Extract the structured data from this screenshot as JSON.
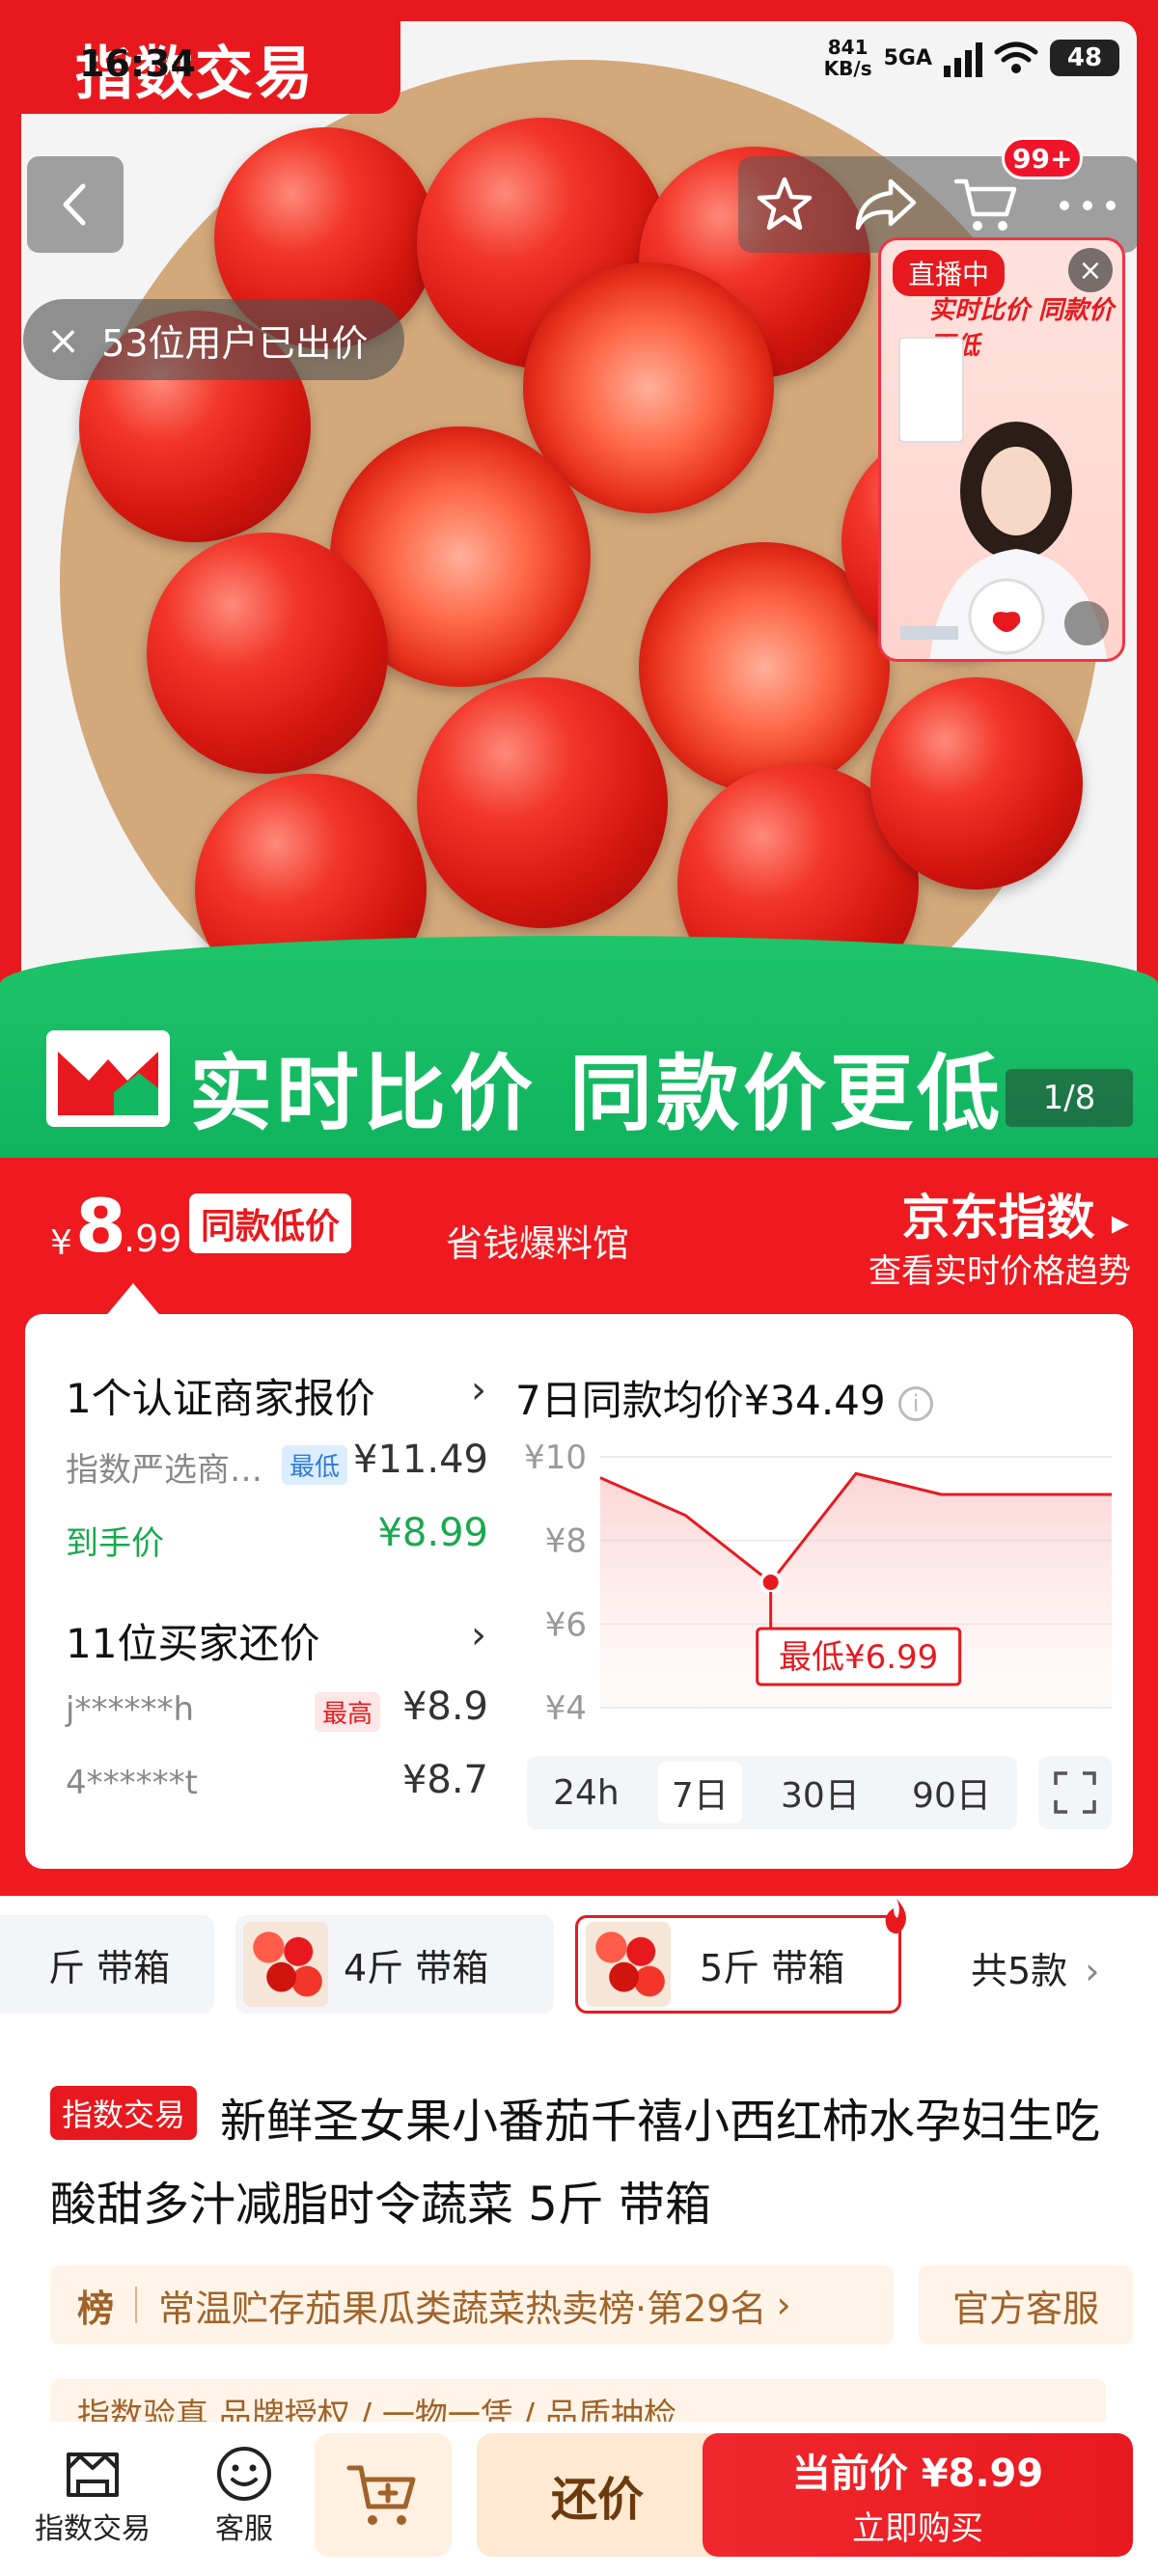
{
  "app": {
    "logo_text": "指数交易"
  },
  "status_bar": {
    "time": "16:34",
    "net_speed_value": "841",
    "net_speed_unit": "KB/s",
    "network": "5GA",
    "battery": "48"
  },
  "nav": {
    "cart_badge": "99+",
    "icons": [
      "back-icon",
      "star-icon",
      "share-icon",
      "cart-icon",
      "more-icon"
    ]
  },
  "bid_notice": {
    "close": "×",
    "text": "53位用户已出价"
  },
  "live": {
    "tag": "直播中",
    "close": "×",
    "banner": "实时比价 同款价更低"
  },
  "hero": {
    "banner_text": "实时比价 同款价更低",
    "image_counter": "1/8"
  },
  "price": {
    "currency": "¥",
    "integer": "8",
    "decimal": ".99",
    "tag": "同款低价",
    "store": "省钱爆料馆",
    "jd_index": "京东指数",
    "jd_index_sub": "查看实时价格趋势"
  },
  "merchants": {
    "title": "1个认证商家报价",
    "row_name": "指数严选商…",
    "row_tag": "最低",
    "row_price": "¥11.49",
    "final_label": "到手价",
    "final_price": "¥8.99"
  },
  "buyers": {
    "title": "11位买家还价",
    "rows": [
      {
        "user": "j******h",
        "tag": "最高",
        "price": "¥8.9"
      },
      {
        "user": "4******t",
        "tag": "",
        "price": "¥8.7"
      }
    ]
  },
  "chart_data": {
    "type": "line",
    "title": "7日同款均价¥34.49",
    "x": [
      1,
      2,
      3,
      4,
      5,
      6,
      7
    ],
    "series": [
      {
        "values": [
          9.5,
          8.6,
          7.0,
          9.6,
          9.1,
          9.1,
          9.1
        ]
      }
    ],
    "ylim": [
      4,
      10
    ],
    "yticks": [
      "¥10",
      "¥8",
      "¥6",
      "¥4"
    ],
    "annotation": "最低¥6.99",
    "grid": true,
    "range_tabs": [
      "24h",
      "7日",
      "30日",
      "90日"
    ],
    "active_range": "7日"
  },
  "sku": {
    "items": [
      {
        "label": "斤 带箱"
      },
      {
        "label": "4斤 带箱"
      },
      {
        "label": "5斤 带箱"
      }
    ],
    "count": "共5款"
  },
  "product": {
    "brand_tag": "指数交易",
    "title": "新鲜圣女果小番茄千禧小西红柿水孕妇生吃酸甜多汁减脂时令蔬菜 5斤 带箱",
    "rank_icon": "榜",
    "rank_text": "常温贮存茄果瓜类蔬菜热卖榜·第29名",
    "service": "官方客服",
    "verify_text": "指数验真  品牌授权 / 一物一凭 / 品质抽检"
  },
  "bottom_bar": {
    "store_label": "指数交易",
    "service_label": "客服",
    "bargain": "还价",
    "buy_price": "当前价 ¥8.99",
    "buy_label": "立即购买"
  },
  "colors": {
    "brand_red": "#e8191e",
    "green": "#12b862",
    "chart_line": "#e8191e"
  }
}
